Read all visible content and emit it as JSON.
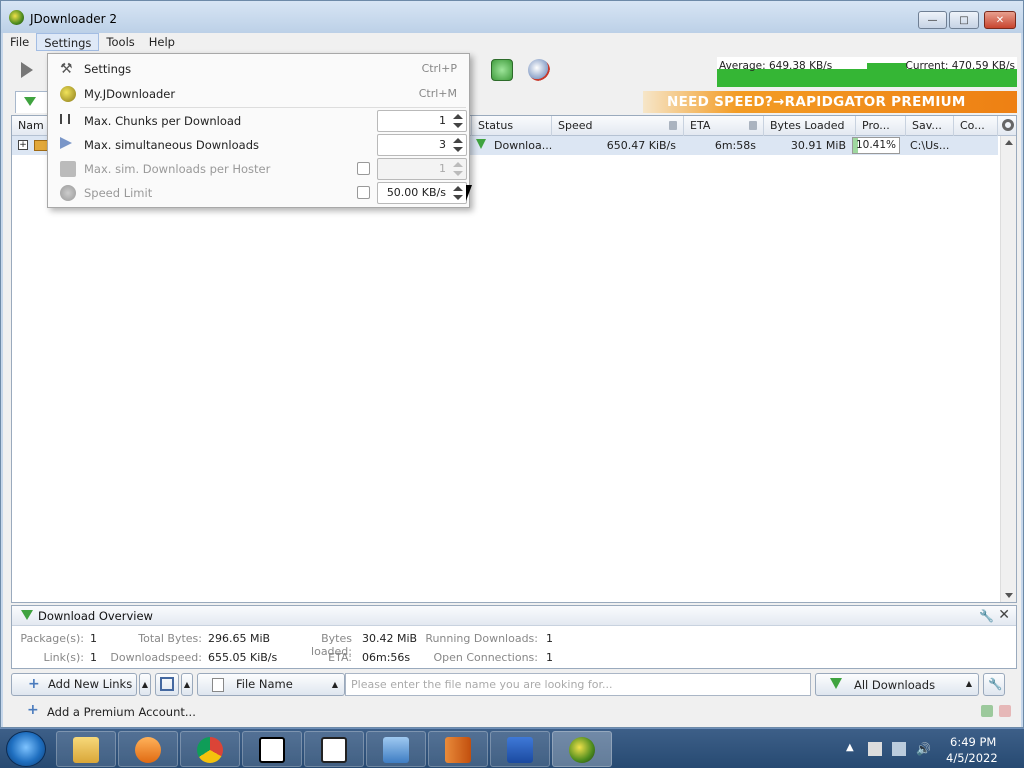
{
  "window": {
    "title": "JDownloader 2"
  },
  "menubar": {
    "items": [
      "File",
      "Settings",
      "Tools",
      "Help"
    ]
  },
  "speed_graph": {
    "average": "Average: 649.38 KB/s",
    "current": "Current: 470.59 KB/s"
  },
  "banner": {
    "text": "NEED SPEED?→RAPIDGATOR PREMIUM"
  },
  "table": {
    "columns": {
      "name": "Nam",
      "status": "Status",
      "speed": "Speed",
      "eta": "ETA",
      "bytes_loaded": "Bytes Loaded",
      "progress": "Pro...",
      "save_to": "Sav...",
      "comment": "Co..."
    },
    "row": {
      "status": "Downloa...",
      "speed": "650.47 KiB/s",
      "eta": "6m:58s",
      "bytes_loaded": "30.91 MiB",
      "progress": "10.41%",
      "progress_value": 0.1041,
      "save_to": "C:\\Us...",
      "expander": "+"
    }
  },
  "settings_menu": {
    "settings": {
      "label": "Settings",
      "shortcut": "Ctrl+P"
    },
    "myjd": {
      "label": "My.JDownloader",
      "shortcut": "Ctrl+M"
    },
    "chunks": {
      "label": "Max. Chunks per Download",
      "value": "1"
    },
    "simultaneous": {
      "label": "Max. simultaneous Downloads",
      "value": "3"
    },
    "per_hoster": {
      "label": "Max. sim. Downloads per Hoster",
      "value": "1"
    },
    "speed_limit": {
      "label": "Speed Limit",
      "value": "50.00 KB/s"
    }
  },
  "overview": {
    "title": "Download Overview",
    "packages_label": "Package(s):",
    "packages_value": "1",
    "total_bytes_label": "Total Bytes:",
    "total_bytes_value": "296.65 MiB",
    "bytes_loaded_label": "Bytes loaded:",
    "bytes_loaded_value": "30.42 MiB",
    "running_label": "Running Downloads:",
    "running_value": "1",
    "links_label": "Link(s):",
    "links_value": "1",
    "dlspeed_label": "Downloadspeed:",
    "dlspeed_value": "655.05 KiB/s",
    "eta_label": "ETA:",
    "eta_value": "06m:56s",
    "connections_label": "Open Connections:",
    "connections_value": "1"
  },
  "bottombar": {
    "add_links": "Add New Links",
    "search_column": "File Name",
    "search_placeholder": "Please enter the file name you are looking for...",
    "filter": "All Downloads",
    "add_premium": "Add a Premium Account..."
  },
  "taskbar": {
    "time": "6:49 PM",
    "date": "4/5/2022"
  },
  "colors": {
    "accent_green": "#35b635",
    "banner_orange": "#ee8013"
  }
}
